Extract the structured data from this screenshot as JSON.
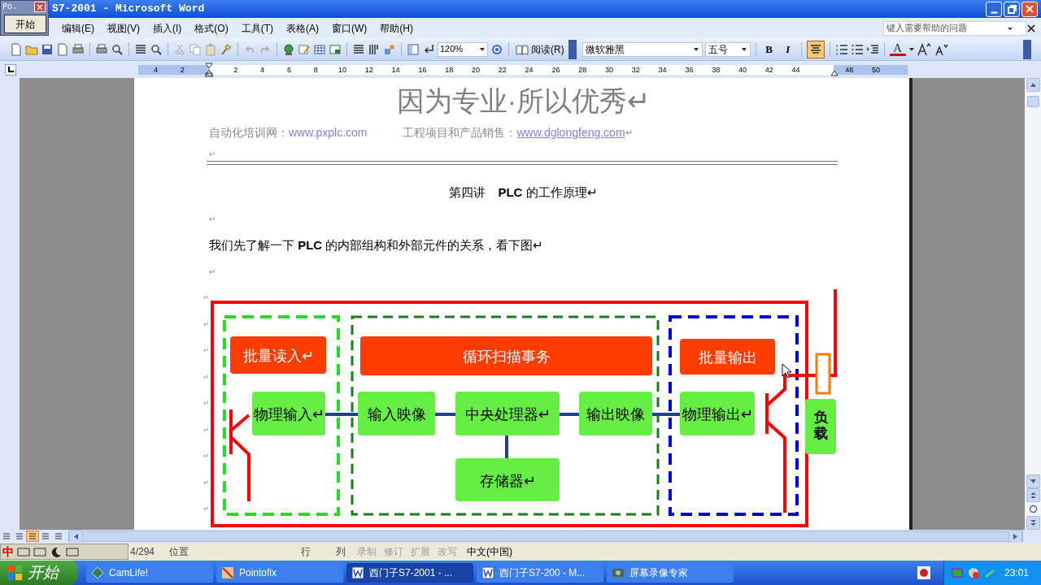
{
  "overlay_window": {
    "title": "Po.",
    "button": "开始"
  },
  "window": {
    "title": "S7-2001 - Microsoft Word"
  },
  "menu": [
    "编辑(E)",
    "视图(V)",
    "插入(I)",
    "格式(O)",
    "工具(T)",
    "表格(A)",
    "窗口(W)",
    "帮助(H)"
  ],
  "help_box": {
    "placeholder": "键入需要帮助的问题"
  },
  "toolbar": {
    "zoom": "120%",
    "read_button": "阅读(R)",
    "font": "微软雅黑",
    "size": "五号",
    "bold": "B",
    "italic": "I",
    "font_color": "A",
    "align_center_on": true
  },
  "ruler": {
    "labels": [
      "4",
      "2",
      "2",
      "4",
      "6",
      "8",
      "10",
      "12",
      "14",
      "16",
      "18",
      "20",
      "22",
      "24",
      "26",
      "28",
      "30",
      "32",
      "34",
      "36",
      "38",
      "40",
      "42",
      "44",
      "48",
      "50"
    ]
  },
  "paragraphs": [
    {
      "kind": "title",
      "text": "因为专业·所以优秀↵"
    },
    {
      "kind": "links",
      "items": [
        {
          "label": "自动化培训网：",
          "link": "www.pxplc.com",
          "underline": false
        },
        {
          "label": "工程项目和产品销售：",
          "link": "www.dglongfeng.com",
          "underline": true
        }
      ],
      "end": "↵"
    },
    {
      "kind": "blank",
      "text": "↵"
    },
    {
      "kind": "rule"
    },
    {
      "kind": "heading",
      "text": "第四讲　**PLC** 的工作原理↵"
    },
    {
      "kind": "blank",
      "text": "↵"
    },
    {
      "kind": "body",
      "text": "我们先了解一下 **PLC** 的内部组构和外部元件的关系，看下图↵"
    },
    {
      "kind": "blank",
      "text": "↵"
    }
  ],
  "diagram": {
    "side_marks": [
      "↵",
      "↵",
      "↵",
      "↵",
      "↵",
      "↵",
      "↵",
      "↵",
      "↵"
    ],
    "blocks": [
      {
        "kind": "stage",
        "text": "批量读入↵"
      },
      {
        "kind": "stage",
        "text": "循环扫描事务"
      },
      {
        "kind": "stage",
        "text": "批量输出"
      },
      {
        "kind": "unit",
        "text": "物理输入↵"
      },
      {
        "kind": "unit",
        "text": "输入映像"
      },
      {
        "kind": "unit",
        "text": "中央处理器↵"
      },
      {
        "kind": "unit",
        "text": "输出映像"
      },
      {
        "kind": "unit",
        "text": "物理输出↵"
      },
      {
        "kind": "unit",
        "text": "存储器↵"
      }
    ],
    "load": "负载"
  },
  "status_bar": {
    "ime": "中",
    "page": "4/294",
    "position": "位置",
    "line": "行",
    "column": "列",
    "indicators": [
      {
        "text": "录制",
        "disabled": true
      },
      {
        "text": "修订",
        "disabled": true
      },
      {
        "text": "扩展",
        "disabled": true
      },
      {
        "text": "改写",
        "disabled": true
      }
    ],
    "language": "中文(中国)"
  },
  "taskbar": {
    "start": "开始",
    "tasks": [
      {
        "label": "CamLife!",
        "selected": false
      },
      {
        "label": "Pointofix",
        "selected": false
      },
      {
        "label": "西门子S7-2001 - ...",
        "selected": true
      },
      {
        "label": "西门子S7-200 - M...",
        "selected": false
      },
      {
        "label": "屏幕录像专家",
        "selected": false
      }
    ],
    "clock": "23:01"
  }
}
